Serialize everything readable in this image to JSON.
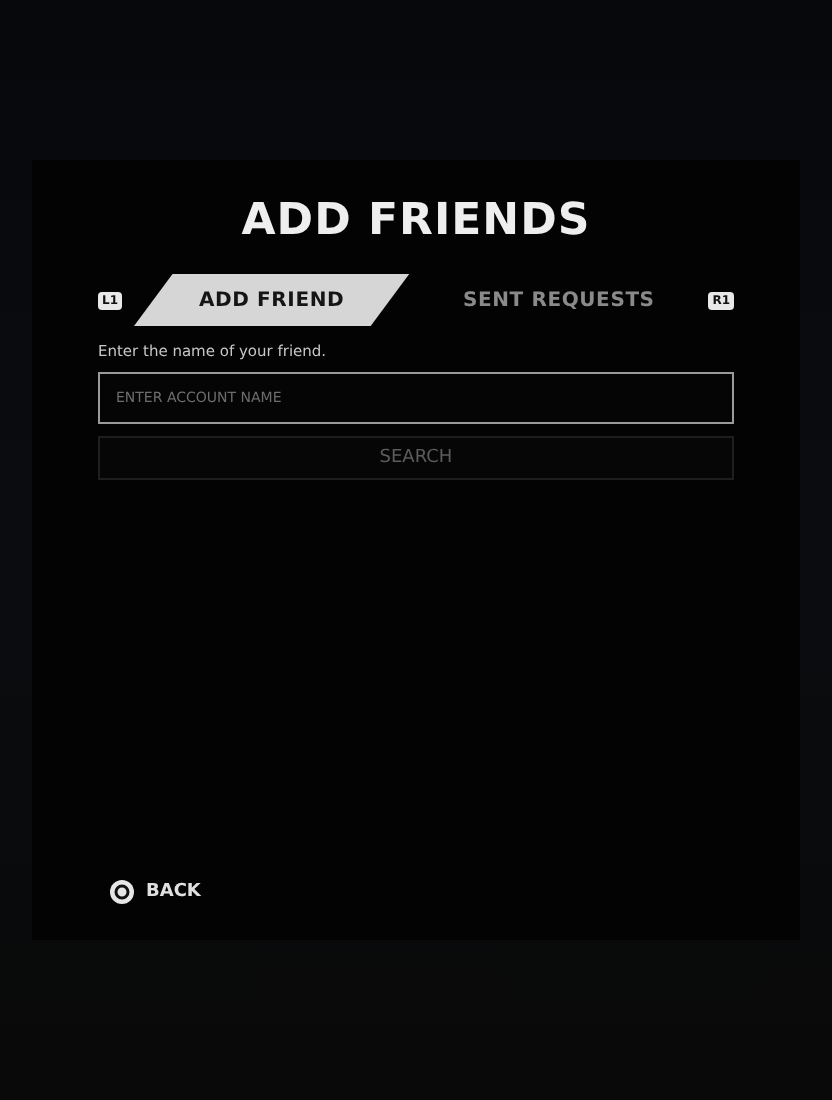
{
  "dialog": {
    "title": "ADD FRIENDS"
  },
  "tab_bar": {
    "left_shoulder": "L1",
    "right_shoulder": "R1"
  },
  "tabs": [
    {
      "label": "ADD FRIEND",
      "selected": true
    },
    {
      "label": "SENT REQUESTS",
      "selected": false
    }
  ],
  "prompt": "Enter the name of your friend.",
  "account_field": {
    "placeholder": "ENTER ACCOUNT NAME"
  },
  "search_button": {
    "label": "SEARCH",
    "disabled": true
  },
  "back": {
    "label": "BACK"
  }
}
